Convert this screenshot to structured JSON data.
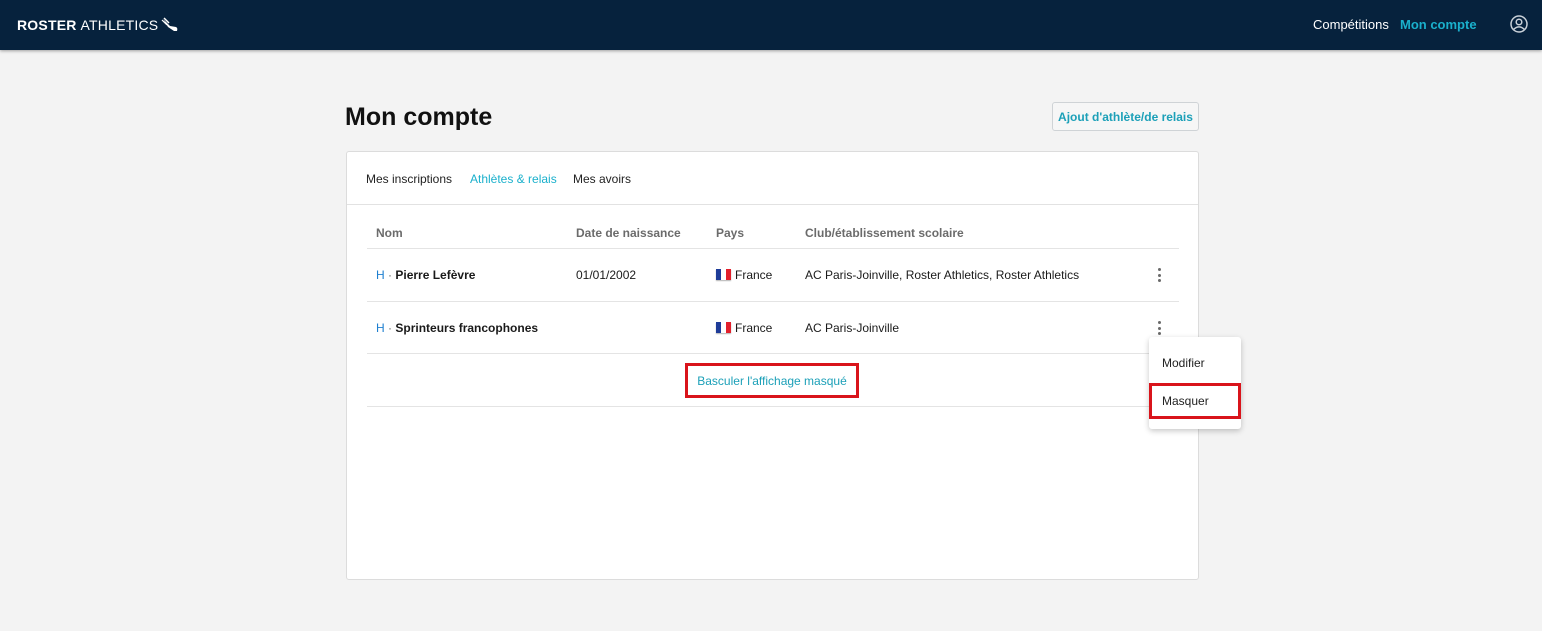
{
  "header": {
    "brand_bold": "ROSTER",
    "brand_light": "ATHLETICS",
    "brand_icon": "winged-shoe-icon",
    "nav": [
      {
        "label": "Compétitions",
        "active": false
      },
      {
        "label": "Mon compte",
        "active": true
      }
    ],
    "user_icon": "user-circle-icon",
    "accent_color": "#1ab0cc",
    "bg_color": "#06223d"
  },
  "page": {
    "title": "Mon compte",
    "add_button": "Ajout d'athlète/de relais"
  },
  "tabs": [
    {
      "label": "Mes inscriptions",
      "active": false
    },
    {
      "label": "Athlètes & relais",
      "active": true
    },
    {
      "label": "Mes avoirs",
      "active": false
    }
  ],
  "table": {
    "columns": [
      "Nom",
      "Date de naissance",
      "Pays",
      "Club/établissement scolaire"
    ],
    "rows": [
      {
        "sex": "H",
        "sep": "·",
        "name": "Pierre Lefèvre",
        "birth": "01/01/2002",
        "country": "France",
        "club": "AC Paris-Joinville, Roster Athletics, Roster Athletics"
      },
      {
        "sex": "H",
        "sep": "·",
        "name": "Sprinteurs francophones",
        "birth": "",
        "country": "France",
        "club": "AC Paris-Joinville"
      }
    ],
    "toggle_link": "Basculer l'affichage masqué"
  },
  "context_menu": {
    "items": [
      "Modifier",
      "Masquer"
    ]
  }
}
